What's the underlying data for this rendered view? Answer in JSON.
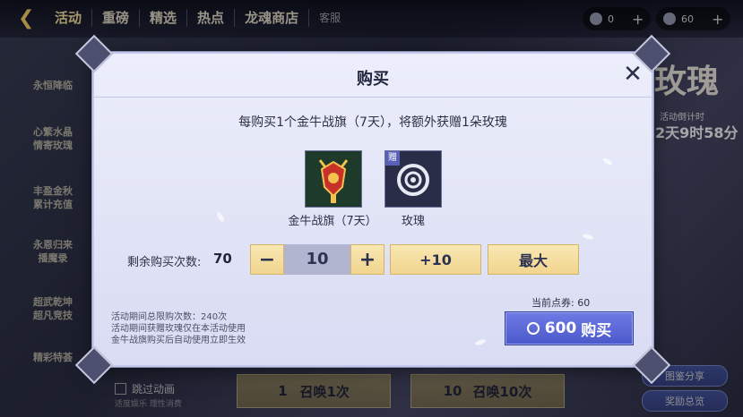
{
  "topbar": {
    "back_label": "活动",
    "tabs": [
      "重磅",
      "精选",
      "热点",
      "龙魂商店"
    ],
    "service_label": "客服",
    "res1_value": "0",
    "res2_value": "60"
  },
  "sidebar": {
    "items": [
      "永恒降临",
      "心繁水晶\n情寄玫瑰",
      "丰盈金秋\n累计充值",
      "永恩归来\n播魔录",
      "超武乾坤\n超凡竞技",
      "精彩特荟"
    ]
  },
  "event": {
    "title": "玫瑰",
    "countdown_label": "活动倒计时",
    "countdown": "2天9时58分"
  },
  "bottom": {
    "skip_label": "跳过动画",
    "skip_sub": "适度娱乐 理性消费",
    "summon1_count": "1",
    "summon1_label": "召唤1次",
    "summon10_count": "10",
    "summon10_label": "召唤10次",
    "share_label": "图鉴分享",
    "reward_label": "奖励总览"
  },
  "dialog": {
    "title": "购买",
    "description": "每购买1个金牛战旗（7天），将额外获赠1朵玫瑰",
    "items": [
      {
        "name": "金牛战旗（7天）",
        "icon": "bull-banner-icon"
      },
      {
        "name": "玫瑰",
        "icon": "rose-icon",
        "badge": "赠"
      }
    ],
    "remain_label": "剩余购买次数:",
    "remain_value": "70",
    "minus": "−",
    "quantity": "10",
    "plus": "+",
    "plus10": "+10",
    "max": "最大",
    "points_label": "当前点券: 60",
    "buy_price": "600",
    "buy_label": "购买",
    "notes": [
      "活动期间总限购次数：240次",
      "活动期间获赠玫瑰仅在本活动使用",
      "金牛战旗购买后自动使用立即生效"
    ]
  }
}
